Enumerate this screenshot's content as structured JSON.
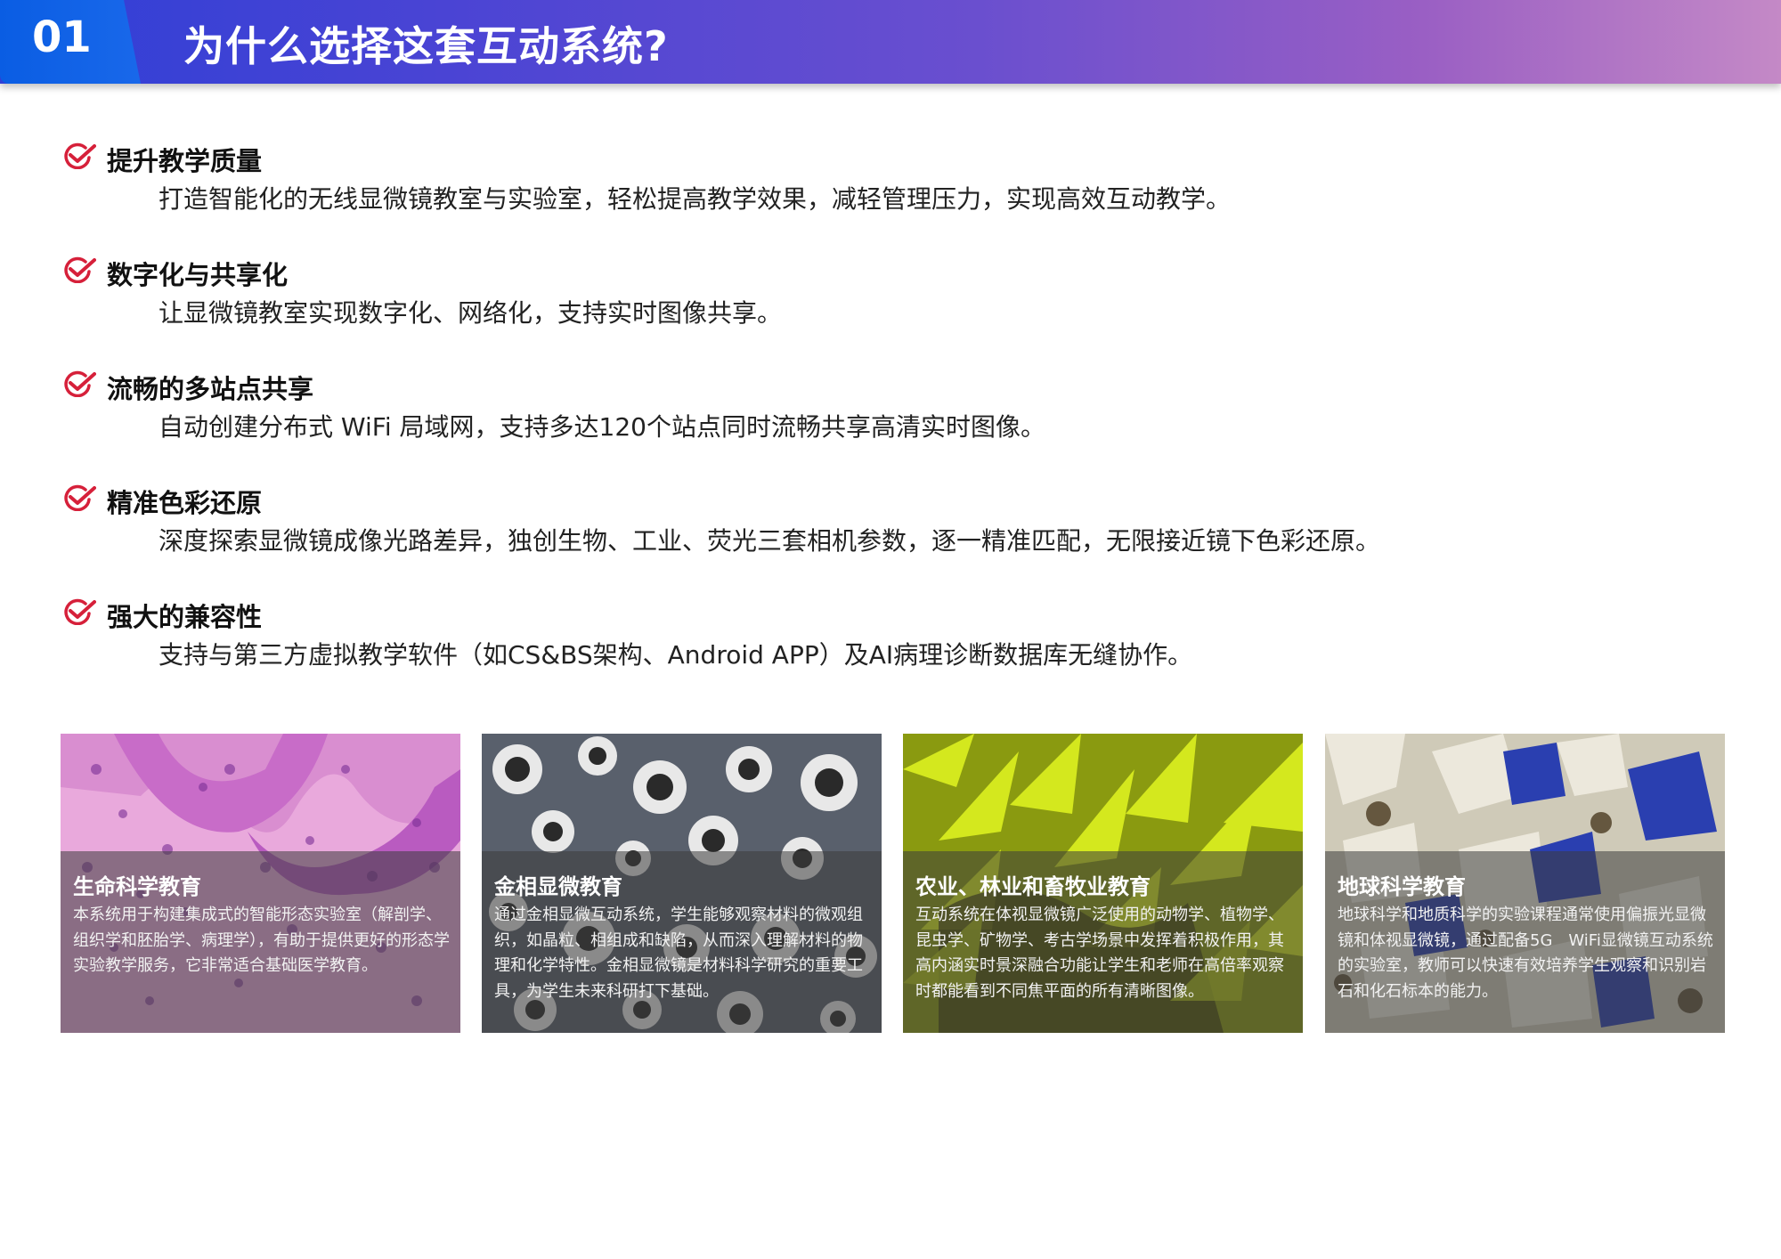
{
  "header": {
    "number": "01",
    "title": "为什么选择这套互动系统?"
  },
  "features": [
    {
      "title": "提升教学质量",
      "desc": "打造智能化的无线显微镜教室与实验室，轻松提高教学效果，减轻管理压力，实现高效互动教学。"
    },
    {
      "title": "数字化与共享化",
      "desc": "让显微镜教室实现数字化、网络化，支持实时图像共享。"
    },
    {
      "title": "流畅的多站点共享",
      "desc": "自动创建分布式 WiFi 局域网，支持多达120个站点同时流畅共享高清实时图像。"
    },
    {
      "title": "精准色彩还原",
      "desc": "深度探索显微镜成像光路差异，独创生物、工业、荧光三套相机参数，逐一精准匹配，无限接近镜下色彩还原。"
    },
    {
      "title": "强大的兼容性",
      "desc": "支持与第三方虚拟教学软件（如CS&BS架构、Android APP）及AI病理诊断数据库无缝协作。"
    }
  ],
  "cards": [
    {
      "title": "生命科学教育",
      "desc": "本系统用于构建集成式的智能形态实验室（解剖学、组织学和胚胎学、病理学），有助于提供更好的形态学实验教学服务，它非常适合基础医学教育。"
    },
    {
      "title": "金相显微教育",
      "desc": "通过金相显微互动系统，学生能够观察材料的微观组织，如晶粒、相组成和缺陷，从而深入理解材料的物理和化学特性。金相显微镜是材料科学研究的重要工具，为学生未来科研打下基础。"
    },
    {
      "title": "农业、林业和畜牧业教育",
      "desc": "互动系统在体视显微镜广泛使用的动物学、植物学、昆虫学、矿物学、考古学场景中发挥着积极作用，其高内涵实时景深融合功能让学生和老师在高倍率观察时都能看到不同焦平面的所有清晰图像。"
    },
    {
      "title": "地球科学教育",
      "desc": "地球科学和地质科学的实验课程通常使用偏振光显微镜和体视显微镜，通过配备5G　WiFi显微镜互动系统的实验室，教师可以快速有效培养学生观察和识别岩石和化石标本的能力。"
    }
  ],
  "colors": {
    "check": "#d6203a",
    "badge": "#1565e8"
  }
}
